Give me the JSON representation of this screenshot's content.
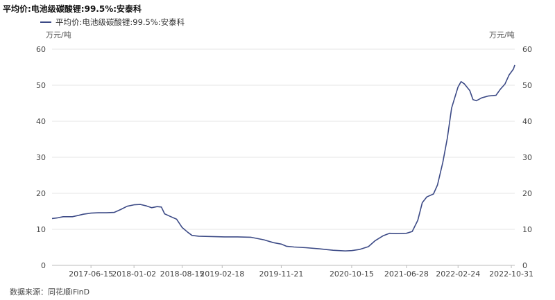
{
  "title": "平均价:电池级碳酸锂:99.5%:安泰科",
  "source": "数据来源：同花顺iFinD",
  "colors": {
    "line": "#3c4a86",
    "grid": "#e6e6e6",
    "axis": "#bbbbbb"
  },
  "chart_data": {
    "type": "line",
    "title": "平均价:电池级碳酸锂:99.5%:安泰科",
    "ylabel_left": "万元/吨",
    "ylabel_right": "万元/吨",
    "ylim": [
      0,
      60
    ],
    "yticks": [
      0,
      10,
      20,
      30,
      40,
      50,
      60
    ],
    "grid": true,
    "legend_position": "top-left",
    "xlim": [
      "2016-12-15",
      "2022-11-16"
    ],
    "xticks": [
      "2017-06-15",
      "2018-01-02",
      "2018-08-15",
      "2019-02-18",
      "2019-11-21",
      "2020-10-15",
      "2021-06-28",
      "2022-02-24",
      "2022-10-31"
    ],
    "series": [
      {
        "name": "平均价:电池级碳酸锂:99.5%:安泰科",
        "points": [
          [
            "2016-12-15",
            13.0
          ],
          [
            "2017-01-10",
            13.2
          ],
          [
            "2017-02-05",
            13.5
          ],
          [
            "2017-03-20",
            13.5
          ],
          [
            "2017-04-20",
            13.9
          ],
          [
            "2017-05-10",
            14.2
          ],
          [
            "2017-06-15",
            14.5
          ],
          [
            "2017-07-20",
            14.6
          ],
          [
            "2017-08-25",
            14.6
          ],
          [
            "2017-10-01",
            14.7
          ],
          [
            "2017-11-01",
            15.5
          ],
          [
            "2017-12-01",
            16.4
          ],
          [
            "2018-01-02",
            16.8
          ],
          [
            "2018-02-01",
            16.9
          ],
          [
            "2018-03-01",
            16.5
          ],
          [
            "2018-03-25",
            16.0
          ],
          [
            "2018-04-20",
            16.3
          ],
          [
            "2018-05-10",
            16.2
          ],
          [
            "2018-05-25",
            14.3
          ],
          [
            "2018-06-20",
            13.6
          ],
          [
            "2018-07-20",
            12.8
          ],
          [
            "2018-08-15",
            10.5
          ],
          [
            "2018-09-10",
            9.2
          ],
          [
            "2018-09-30",
            8.3
          ],
          [
            "2018-11-01",
            8.1
          ],
          [
            "2019-01-01",
            8.0
          ],
          [
            "2019-03-01",
            7.9
          ],
          [
            "2019-05-01",
            7.9
          ],
          [
            "2019-07-01",
            7.8
          ],
          [
            "2019-09-01",
            7.1
          ],
          [
            "2019-10-15",
            6.3
          ],
          [
            "2019-11-21",
            5.9
          ],
          [
            "2019-12-15",
            5.3
          ],
          [
            "2020-01-20",
            5.1
          ],
          [
            "2020-03-15",
            4.9
          ],
          [
            "2020-05-15",
            4.6
          ],
          [
            "2020-07-20",
            4.2
          ],
          [
            "2020-09-15",
            4.0
          ],
          [
            "2020-10-15",
            4.1
          ],
          [
            "2020-11-20",
            4.4
          ],
          [
            "2021-01-01",
            5.2
          ],
          [
            "2021-02-01",
            6.8
          ],
          [
            "2021-03-10",
            8.2
          ],
          [
            "2021-04-10",
            8.9
          ],
          [
            "2021-05-10",
            8.8
          ],
          [
            "2021-06-28",
            8.9
          ],
          [
            "2021-07-25",
            9.4
          ],
          [
            "2021-08-20",
            12.5
          ],
          [
            "2021-09-10",
            17.4
          ],
          [
            "2021-10-01",
            19.0
          ],
          [
            "2021-11-01",
            19.8
          ],
          [
            "2021-11-20",
            22.3
          ],
          [
            "2021-12-15",
            28.6
          ],
          [
            "2022-01-05",
            35.3
          ],
          [
            "2022-01-25",
            43.7
          ],
          [
            "2022-02-24",
            49.5
          ],
          [
            "2022-03-10",
            51.0
          ],
          [
            "2022-03-25",
            50.4
          ],
          [
            "2022-04-20",
            48.5
          ],
          [
            "2022-05-05",
            46.0
          ],
          [
            "2022-05-20",
            45.7
          ],
          [
            "2022-06-15",
            46.5
          ],
          [
            "2022-07-15",
            47.0
          ],
          [
            "2022-08-20",
            47.2
          ],
          [
            "2022-09-10",
            48.9
          ],
          [
            "2022-10-01",
            50.3
          ],
          [
            "2022-10-20",
            52.8
          ],
          [
            "2022-11-10",
            54.5
          ],
          [
            "2022-11-16",
            55.6
          ]
        ]
      }
    ]
  }
}
